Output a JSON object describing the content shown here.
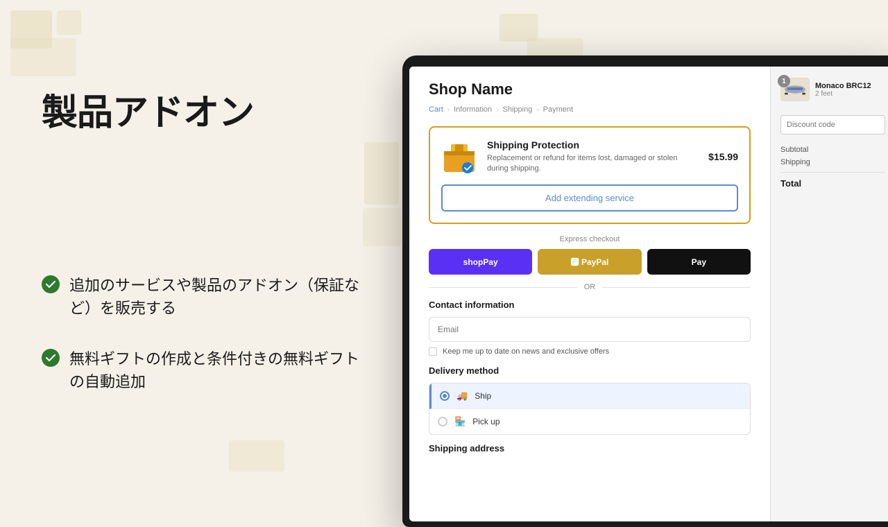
{
  "left": {
    "title": "製品アドオン",
    "features": [
      {
        "id": "feature-1",
        "text": "追加のサービスや製品のアドオン（保証など）を販売する"
      },
      {
        "id": "feature-2",
        "text": "無料ギフトの作成と条件付きの無料ギフトの自動追加"
      }
    ]
  },
  "checkout": {
    "shop_name": "Shop Name",
    "breadcrumb": {
      "cart": "Cart",
      "information": "Information",
      "shipping": "Shipping",
      "payment": "Payment"
    },
    "protection": {
      "title": "Shipping Protection",
      "description": "Replacement or refund for items lost, damaged or stolen during shipping.",
      "price": "$15.99",
      "button_label": "Add extending service"
    },
    "express": {
      "label": "Express checkout",
      "shoppay": "shopPay",
      "paypal": "PayPal",
      "applepay": "Apple Pay"
    },
    "or_text": "OR",
    "contact": {
      "title": "Contact information",
      "email_placeholder": "Email",
      "newsletter_label": "Keep me up to date on news and exclusive offers"
    },
    "delivery": {
      "title": "Delivery method",
      "options": [
        {
          "id": "ship",
          "label": "Ship",
          "selected": true
        },
        {
          "id": "pickup",
          "label": "Pick up",
          "selected": false
        }
      ]
    },
    "shipping_address_title": "Shipping address"
  },
  "sidebar": {
    "product": {
      "name": "Monaco BRC12",
      "size": "2 feet",
      "badge": "1"
    },
    "discount_placeholder": "Discount code",
    "subtotal_label": "Subtotal",
    "shipping_label": "Shipping",
    "total_label": "Total"
  }
}
